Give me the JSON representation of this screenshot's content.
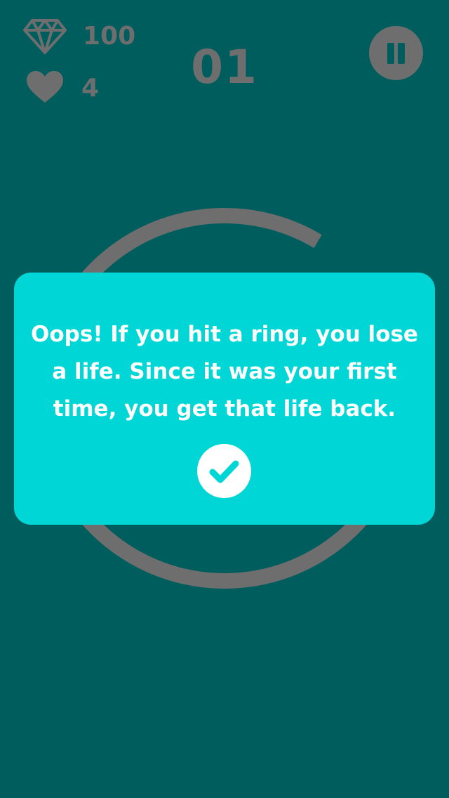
{
  "hud": {
    "gems": "100",
    "lives": "4",
    "level": "01",
    "gem_icon": "diamond-icon",
    "life_icon": "heart-icon",
    "pause_icon": "pause-icon"
  },
  "dialog": {
    "message": "Oops! If you hit a ring, you lose a life. Since it was your first time, you get that life back.",
    "confirm_icon": "checkmark-icon"
  },
  "colors": {
    "background": "#005d5d",
    "hud": "#6e6e6e",
    "ring": "#6e6e6e",
    "dialog": "#00d6d6",
    "text": "#ffffff"
  }
}
